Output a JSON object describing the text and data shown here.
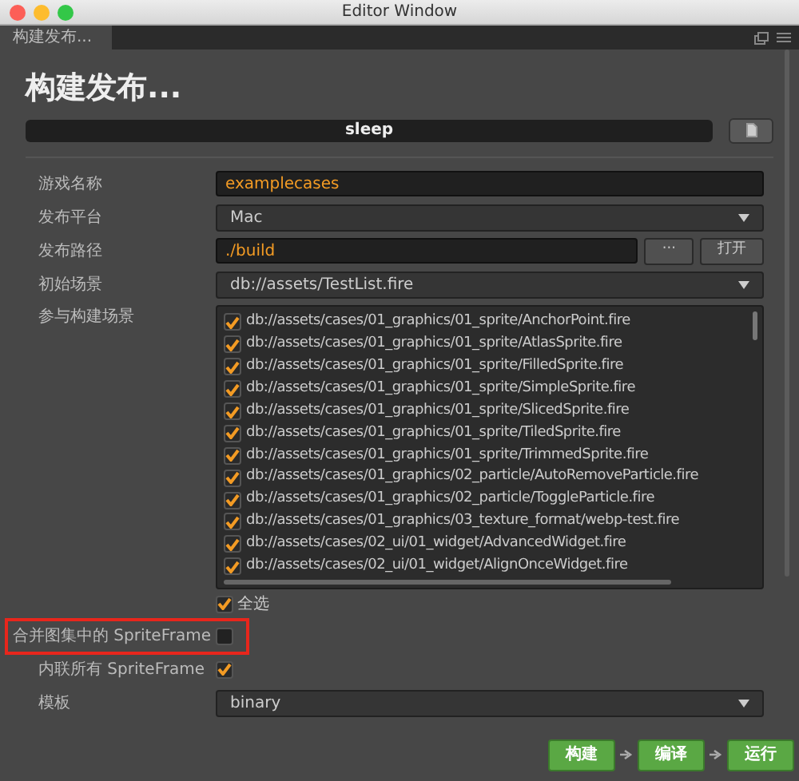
{
  "window": {
    "title": "Editor Window"
  },
  "tab": {
    "label": "构建发布...",
    "selected": true
  },
  "heading": "构建发布...",
  "build_name": "sleep",
  "fields": [
    {
      "kind": "input",
      "label": "游戏名称",
      "value": "examplecases"
    },
    {
      "kind": "select",
      "label": "发布平台",
      "value": "Mac"
    },
    {
      "kind": "path",
      "label": "发布路径",
      "value": "./build",
      "buttons": [
        "···",
        "打开"
      ]
    },
    {
      "kind": "select",
      "label": "初始场景",
      "value": "db://assets/TestList.fire"
    }
  ],
  "scenes": {
    "label": "参与构建场景",
    "items": [
      {
        "path": "db://assets/cases/01_graphics/01_sprite/AnchorPoint.fire",
        "checked": true
      },
      {
        "path": "db://assets/cases/01_graphics/01_sprite/AtlasSprite.fire",
        "checked": true
      },
      {
        "path": "db://assets/cases/01_graphics/01_sprite/FilledSprite.fire",
        "checked": true
      },
      {
        "path": "db://assets/cases/01_graphics/01_sprite/SimpleSprite.fire",
        "checked": true
      },
      {
        "path": "db://assets/cases/01_graphics/01_sprite/SlicedSprite.fire",
        "checked": true
      },
      {
        "path": "db://assets/cases/01_graphics/01_sprite/TiledSprite.fire",
        "checked": true
      },
      {
        "path": "db://assets/cases/01_graphics/01_sprite/TrimmedSprite.fire",
        "checked": true
      },
      {
        "path": "db://assets/cases/01_graphics/02_particle/AutoRemoveParticle.fire",
        "checked": true
      },
      {
        "path": "db://assets/cases/01_graphics/02_particle/ToggleParticle.fire",
        "checked": true
      },
      {
        "path": "db://assets/cases/01_graphics/03_texture_format/webp-test.fire",
        "checked": true
      },
      {
        "path": "db://assets/cases/02_ui/01_widget/AdvancedWidget.fire",
        "checked": true
      },
      {
        "path": "db://assets/cases/02_ui/01_widget/AlignOnceWidget.fire",
        "checked": true
      }
    ],
    "select_all": {
      "label": "全选",
      "checked": true
    }
  },
  "options": [
    {
      "label": "合并图集中的 SpriteFrame",
      "checked": false,
      "highlighted": true
    },
    {
      "label": "内联所有 SpriteFrame",
      "checked": true,
      "highlighted": false
    }
  ],
  "template": {
    "label": "模板",
    "value": "binary"
  },
  "actions": [
    "构建",
    "编译",
    "运行"
  ]
}
